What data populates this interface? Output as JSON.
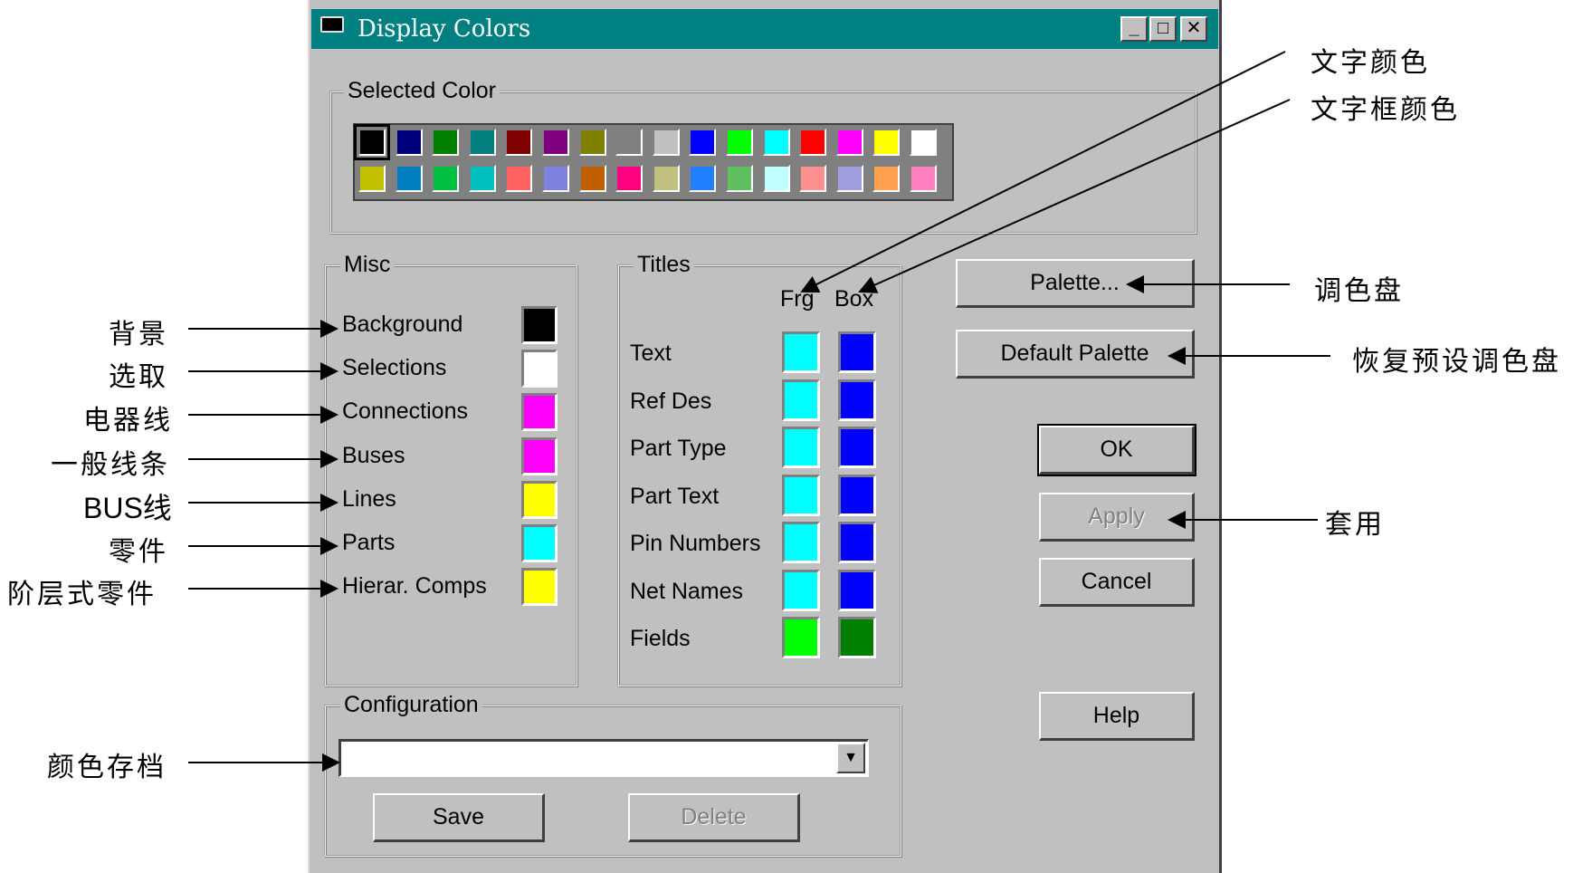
{
  "window": {
    "title": "Display Colors",
    "minimize": "_",
    "maximize": "□",
    "close": "✕"
  },
  "selected_color": {
    "label": "Selected Color",
    "palette": [
      "#000000",
      "#00007f",
      "#007f00",
      "#007f7f",
      "#7f0000",
      "#7f007f",
      "#7f7f00",
      "#7f7f7f",
      "#c0c0c0",
      "#0000ff",
      "#00ff00",
      "#00ffff",
      "#ff0000",
      "#ff00ff",
      "#ffff00",
      "#ffffff",
      "#c0c000",
      "#0080c0",
      "#00c040",
      "#00c0c0",
      "#ff6060",
      "#8080e0",
      "#c06000",
      "#ff0080",
      "#c0c080",
      "#2080ff",
      "#60c060",
      "#c0ffff",
      "#ff9090",
      "#a0a0e0",
      "#ffa050",
      "#ff80c0"
    ]
  },
  "misc": {
    "label": "Misc",
    "items": [
      {
        "label": "Background",
        "color": "#000000"
      },
      {
        "label": "Selections",
        "color": "#ffffff"
      },
      {
        "label": "Connections",
        "color": "#ff00ff"
      },
      {
        "label": "Buses",
        "color": "#ff00ff"
      },
      {
        "label": "Lines",
        "color": "#ffff00"
      },
      {
        "label": "Parts",
        "color": "#00ffff"
      },
      {
        "label": "Hierar. Comps",
        "color": "#ffff00"
      }
    ]
  },
  "titles": {
    "label": "Titles",
    "col_frg": "Frg",
    "col_box": "Box",
    "items": [
      {
        "label": "Text",
        "frg": "#00ffff",
        "box": "#0000ff"
      },
      {
        "label": "Ref Des",
        "frg": "#00ffff",
        "box": "#0000ff"
      },
      {
        "label": "Part Type",
        "frg": "#00ffff",
        "box": "#0000ff"
      },
      {
        "label": "Part Text",
        "frg": "#00ffff",
        "box": "#0000ff"
      },
      {
        "label": "Pin Numbers",
        "frg": "#00ffff",
        "box": "#0000ff"
      },
      {
        "label": "Net Names",
        "frg": "#00ffff",
        "box": "#0000ff"
      },
      {
        "label": "Fields",
        "frg": "#00ff00",
        "box": "#008000"
      }
    ]
  },
  "configuration": {
    "label": "Configuration",
    "value": "",
    "save": "Save",
    "delete": "Delete"
  },
  "buttons": {
    "palette": "Palette...",
    "default_palette": "Default Palette",
    "ok": "OK",
    "apply": "Apply",
    "cancel": "Cancel",
    "help": "Help"
  },
  "annotations": {
    "background": "背景",
    "selections": "选取",
    "connections": "电器线",
    "buses": "一般线条",
    "lines": "BUS线",
    "parts": "零件",
    "hierar": "阶层式零件",
    "config": "颜色存档",
    "text_color": "文字颜色",
    "box_color": "文字框颜色",
    "palette": "调色盘",
    "default_palette": "恢复预设调色盘",
    "apply": "套用"
  }
}
